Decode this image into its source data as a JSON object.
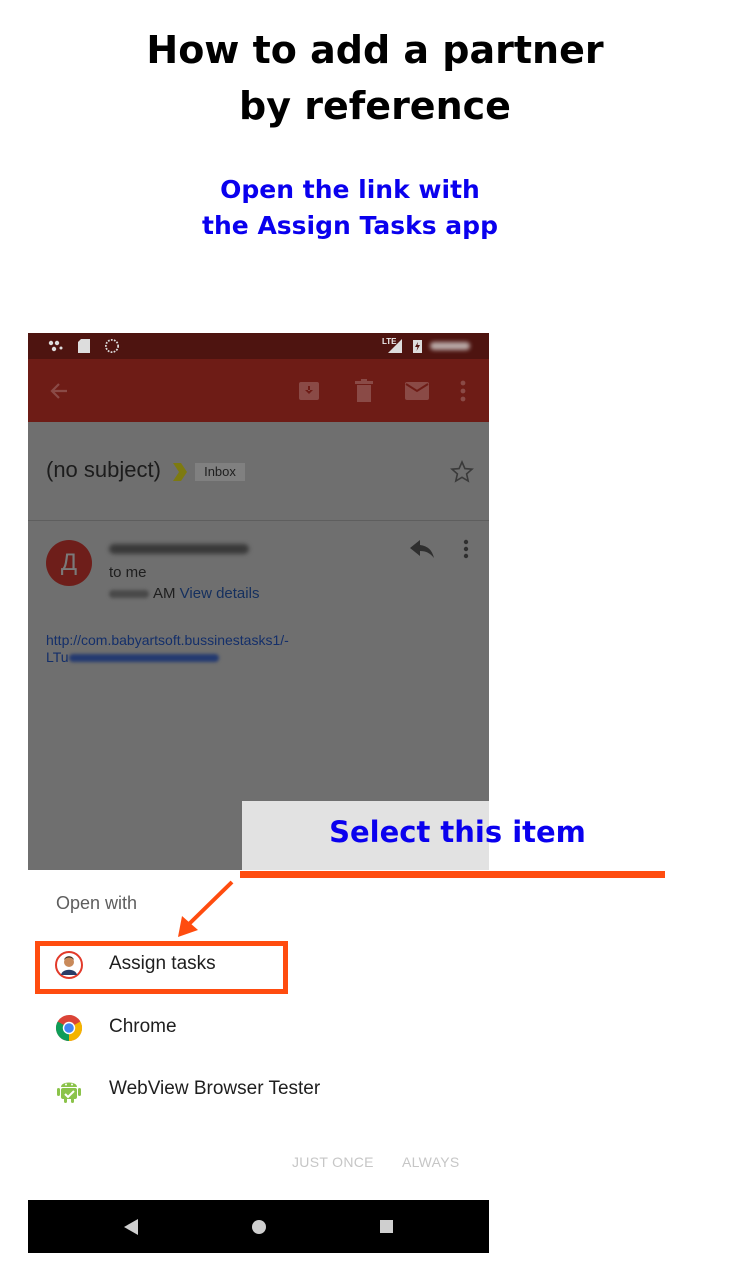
{
  "heading": {
    "line1": "How to add a partner",
    "line2": "by reference"
  },
  "subheading": {
    "line1": "Open the link with",
    "line2": "the Assign Tasks app"
  },
  "callout": "Select this item",
  "phone": {
    "statusbar": {
      "network_label": "LTE",
      "icons": [
        "assistant-dots-icon",
        "sd-card-icon",
        "sync-circle-icon",
        "signal-icon",
        "battery-charging-icon"
      ]
    },
    "appbar": {
      "icons": [
        "back-arrow-icon",
        "archive-icon",
        "delete-icon",
        "mail-icon",
        "more-vert-icon"
      ]
    },
    "email": {
      "subject": "(no subject)",
      "label": "Inbox",
      "sender_initial": "Д",
      "recipient": "to me",
      "time_suffix": "AM",
      "view_details": "View details",
      "link_line1": "http://com.babyartsoft.bussinestasks1/-",
      "link_line2_prefix": "LTu"
    },
    "sheet": {
      "title": "Open with",
      "apps": [
        {
          "label": "Assign tasks",
          "icon": "assign-tasks-app-icon"
        },
        {
          "label": "Chrome",
          "icon": "chrome-icon"
        },
        {
          "label": "WebView Browser Tester",
          "icon": "android-icon"
        }
      ],
      "just_once": "JUST ONCE",
      "always": "ALWAYS"
    },
    "navbar": {
      "icons": [
        "back-triangle-icon",
        "home-circle-icon",
        "recents-square-icon"
      ]
    }
  },
  "colors": {
    "title": "#000000",
    "accent_blue": "#0a00ee",
    "highlight_orange": "#ff4c0f",
    "appbar_red": "#6e1c16"
  }
}
